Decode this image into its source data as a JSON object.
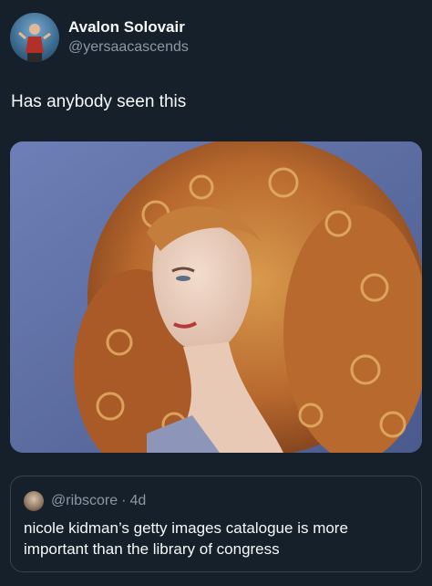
{
  "author": {
    "display_name": "Avalon Solovair",
    "handle": "@yersaacascends"
  },
  "tweet": {
    "text": "Has anybody seen this"
  },
  "media": {
    "subject": "portrait-photo-curly-red-hair"
  },
  "quote": {
    "handle": "@ribscore",
    "separator": "·",
    "time": "4d",
    "text": "nicole kidman’s getty images catalogue is more important than the library of congress"
  },
  "colors": {
    "background": "#15202b",
    "primary_text": "#f7f9f9",
    "secondary_text": "#8b98a5",
    "border": "#38444d"
  }
}
